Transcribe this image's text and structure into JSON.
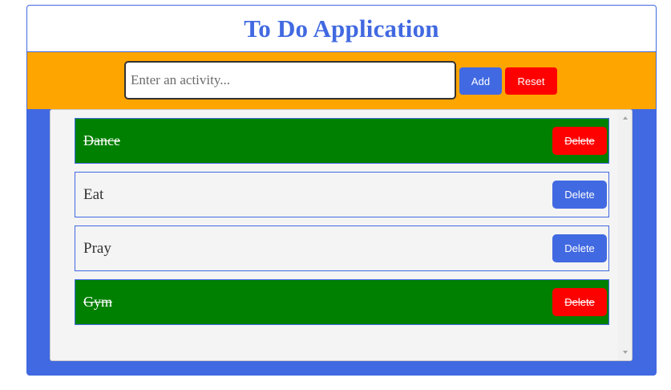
{
  "app": {
    "title": "To Do Application"
  },
  "toolbar": {
    "input_placeholder": "Enter an activity...",
    "input_value": "",
    "add_label": "Add",
    "reset_label": "Reset"
  },
  "todos": [
    {
      "text": "Dance",
      "done": true,
      "delete_label": "Delete"
    },
    {
      "text": "Eat",
      "done": false,
      "delete_label": "Delete"
    },
    {
      "text": "Pray",
      "done": false,
      "delete_label": "Delete"
    },
    {
      "text": "Gym",
      "done": true,
      "delete_label": "Delete"
    }
  ],
  "colors": {
    "accent": "#4169e1",
    "toolbar": "#ffa500",
    "done": "#008000",
    "danger": "#ff0000"
  },
  "icons": {
    "scroll_up": "scroll-up-arrow-icon",
    "scroll_down": "scroll-down-arrow-icon"
  }
}
